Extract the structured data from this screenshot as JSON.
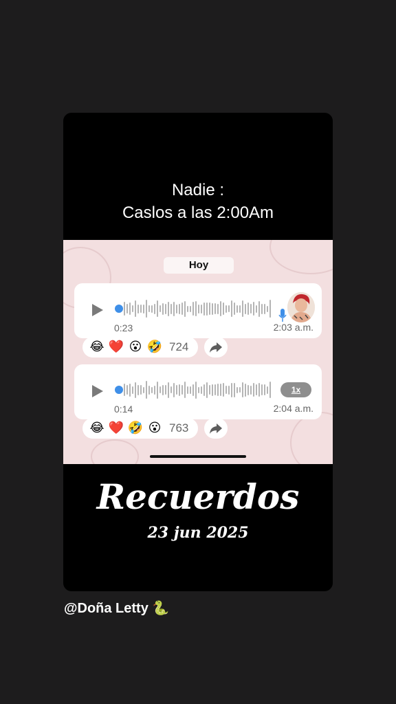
{
  "caption": {
    "line1": "Nadie :",
    "line2": "Caslos a las 2:00Am"
  },
  "chat": {
    "day_label": "Hoy",
    "messages": [
      {
        "duration": "0:23",
        "time": "2:03 a.m.",
        "reactions": [
          "😂",
          "❤️",
          "😮",
          "🤣"
        ],
        "reaction_count": "724"
      },
      {
        "duration": "0:14",
        "time": "2:04 a.m.",
        "speed": "1x",
        "reactions": [
          "😂",
          "❤️",
          "🤣",
          "😮"
        ],
        "reaction_count": "763"
      }
    ]
  },
  "overlay": {
    "title": "Recuerdos",
    "date": "23 jun 2025"
  },
  "author": {
    "handle": "@Doña Letty",
    "emoji": "🐍"
  },
  "colors": {
    "background": "#1d1c1d",
    "chat_bg": "#f3dfe0",
    "progress_dot": "#3f8fe8"
  }
}
